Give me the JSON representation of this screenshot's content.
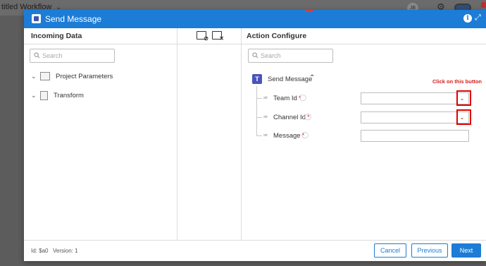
{
  "background": {
    "workflow_title": "titled Workflow",
    "avatar_initials": "JB"
  },
  "modal": {
    "title": "Send Message",
    "info_icon": "info-icon",
    "expand_icon": "expand-icon"
  },
  "incoming": {
    "heading": "Incoming Data",
    "search_placeholder": "Search",
    "items": [
      {
        "label": "Project Parameters",
        "icon": "parameters-icon"
      },
      {
        "label": "Transform",
        "icon": "transform-icon"
      }
    ]
  },
  "mapping_tools": {
    "link_icon": "link-mapping-icon",
    "unlink_icon": "unlink-mapping-icon"
  },
  "action": {
    "heading": "Action Configure",
    "search_placeholder": "Search",
    "node_label": "Send Message",
    "fields": [
      {
        "type": "str",
        "label": "Team Id",
        "required": "*",
        "value": "",
        "has_dropdown": true
      },
      {
        "type": "str",
        "label": "Channel Id",
        "required": "*",
        "value": "",
        "has_dropdown": true
      },
      {
        "type": "str",
        "label": "Message",
        "required": "*",
        "value": "",
        "has_dropdown": false
      }
    ]
  },
  "annotation": {
    "text": "Click on this button",
    "color": "#d0211c"
  },
  "footer": {
    "id_text": "Id: $a0",
    "version_text": "Version: 1",
    "cancel_label": "Cancel",
    "previous_label": "Previous",
    "next_label": "Next"
  },
  "colors": {
    "accent": "#1c7cd6",
    "required": "#e13232",
    "highlight": "#e00000"
  }
}
